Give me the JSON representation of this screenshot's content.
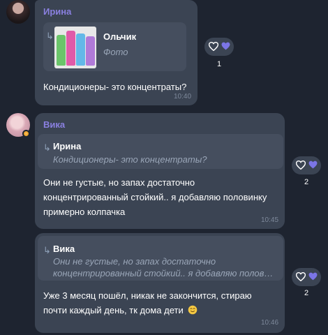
{
  "messages": [
    {
      "sender": "Ирина",
      "reply": {
        "name": "Ольчик",
        "text": "Фото"
      },
      "text": "Кондиционеры- это концентраты?",
      "time": "10:40",
      "reactions": "1"
    },
    {
      "sender": "Вика",
      "reply": {
        "name": "Ирина",
        "text": "Кондиционеры- это концентраты?"
      },
      "text_lines": [
        "Они не густые,  но запах достаточно",
        "концентрированный стойкий.. я добавляю половинку",
        "примерно колпачка"
      ],
      "time": "10:45",
      "reactions": "2"
    },
    {
      "reply": {
        "name": "Вика",
        "line1": "Они не густые,  но запах достаточно",
        "line2": "концентрированный стойкий.. я добавляю полови…"
      },
      "text_lines": [
        "Уже 3 месяц пошёл,  никак не закончится, стираю",
        "почти каждый день, тк дома дети"
      ],
      "time": "10:46",
      "reactions": "2"
    }
  ],
  "colors": {
    "sender": "#8a80e0",
    "bubble": "#3b4453",
    "heart_filled": "#7b75e6"
  },
  "icons": {
    "reply": "reply-arrow-icon",
    "heart_outline": "heart-outline-icon",
    "heart_filled": "heart-filled-icon",
    "emoji": "smiling-emoji-icon"
  }
}
